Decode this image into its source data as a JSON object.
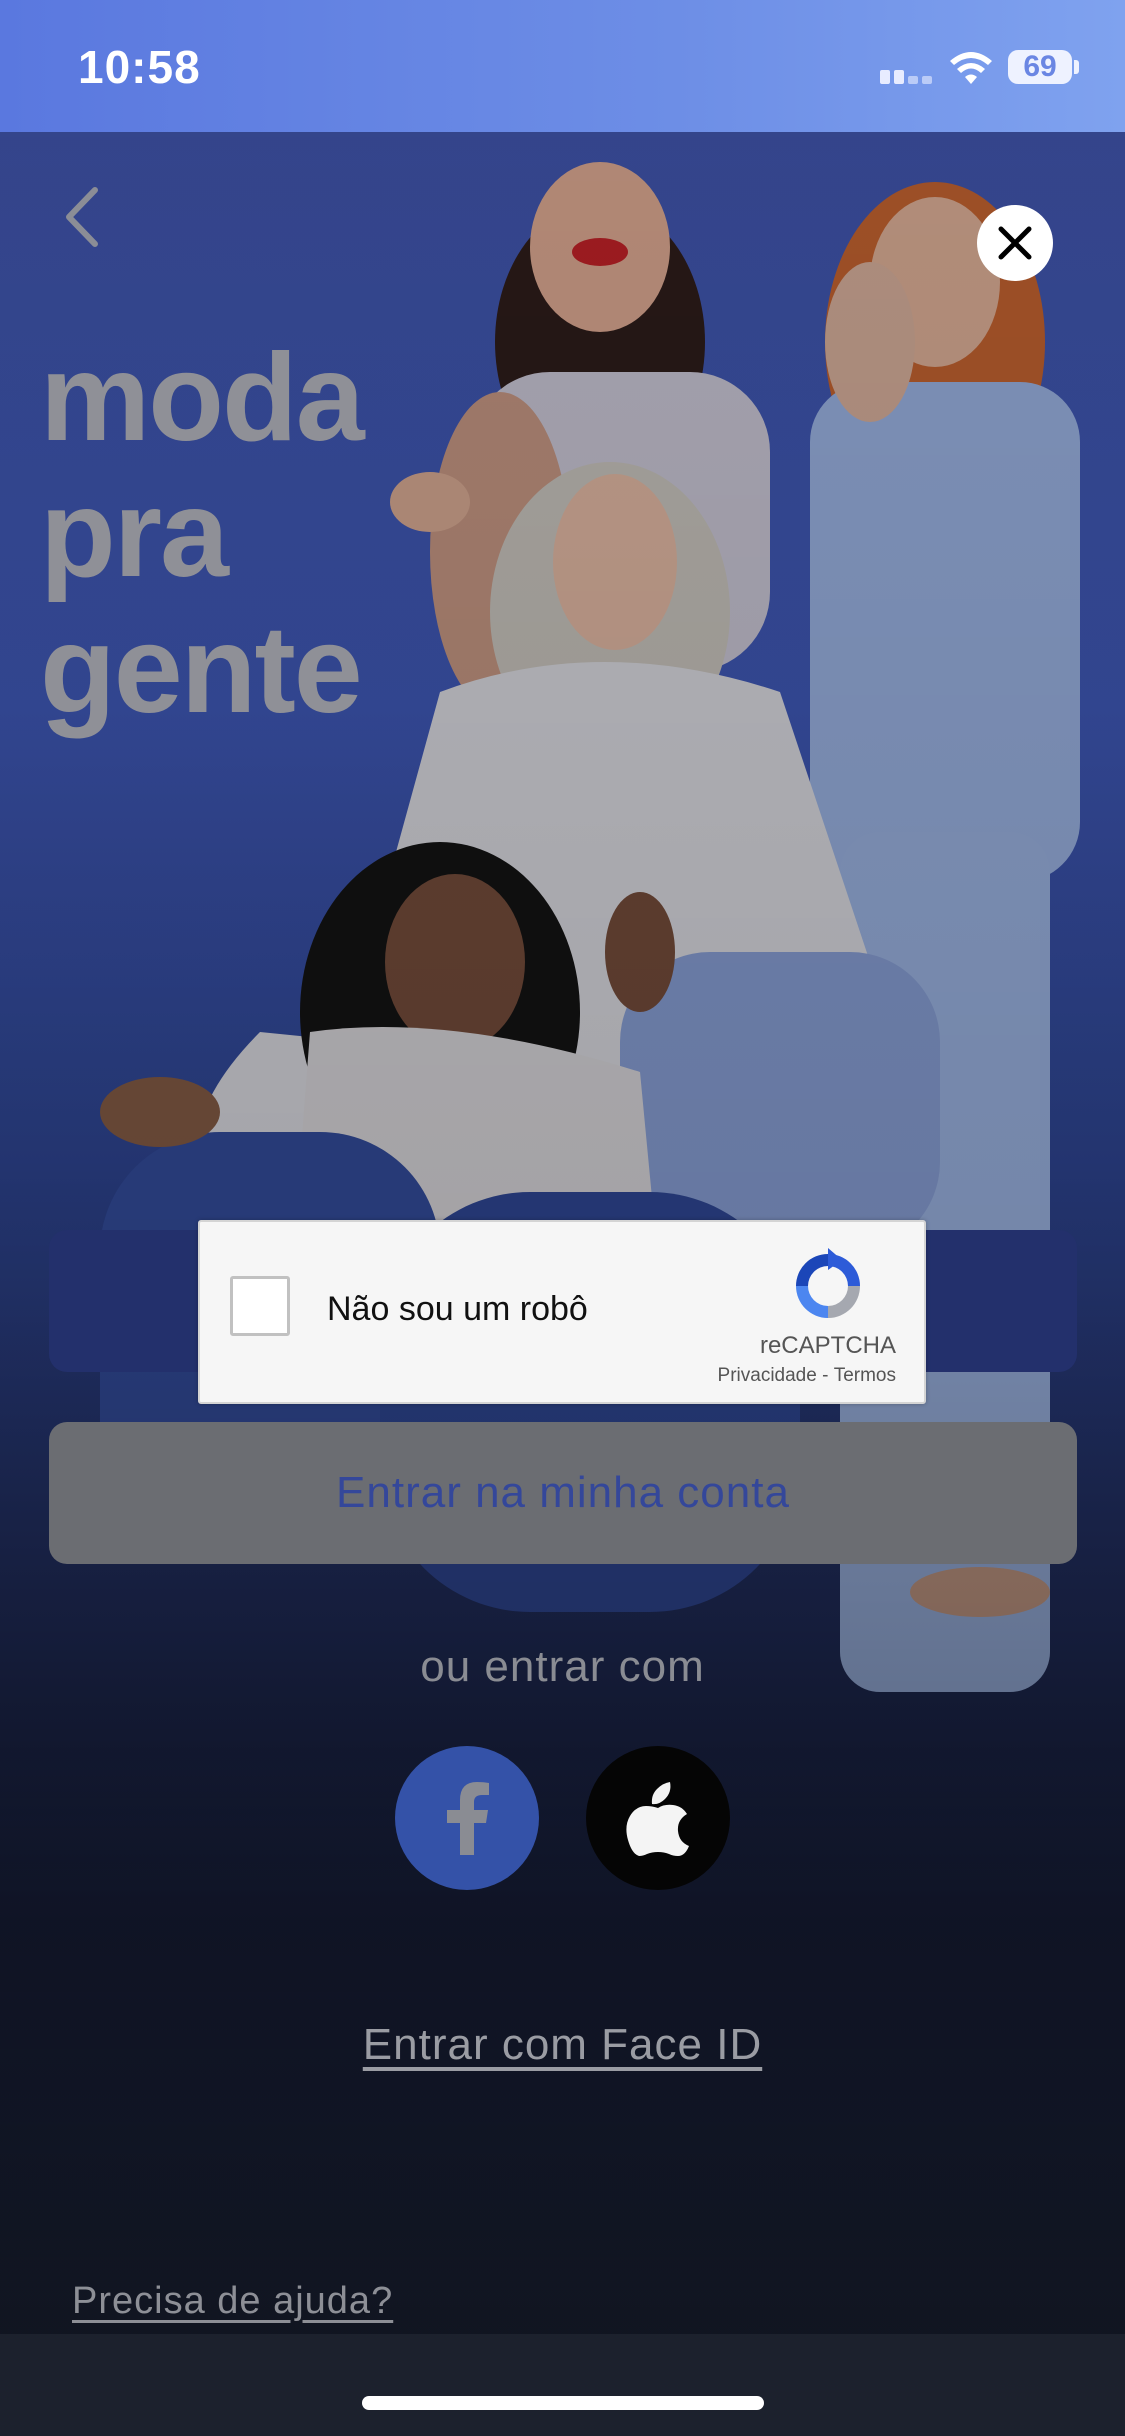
{
  "status_bar": {
    "time": "10:58",
    "battery": "69"
  },
  "header": {
    "back_icon": "chevron-left-icon",
    "close_icon": "close-icon"
  },
  "hero": {
    "headline_lines": [
      "moda",
      "pra",
      "gente"
    ],
    "photo": "four women in white tops and denim posing"
  },
  "recaptcha": {
    "label": "Não sou um robô",
    "brand": "reCAPTCHA",
    "privacy": "Privacidade",
    "separator": " - ",
    "terms": "Termos"
  },
  "actions": {
    "primary_button_label": "",
    "account_button": "Entrar na minha conta",
    "or_text": "ou entrar com",
    "social": [
      {
        "name": "facebook",
        "icon": "facebook-icon"
      },
      {
        "name": "apple",
        "icon": "apple-icon"
      }
    ],
    "face_id": "Entrar com Face ID",
    "help": "Precisa de ajuda?"
  },
  "colors": {
    "primary_button": "#23306c",
    "account_button_text": "#34479a",
    "facebook": "#3452a8",
    "apple": "#050505"
  }
}
